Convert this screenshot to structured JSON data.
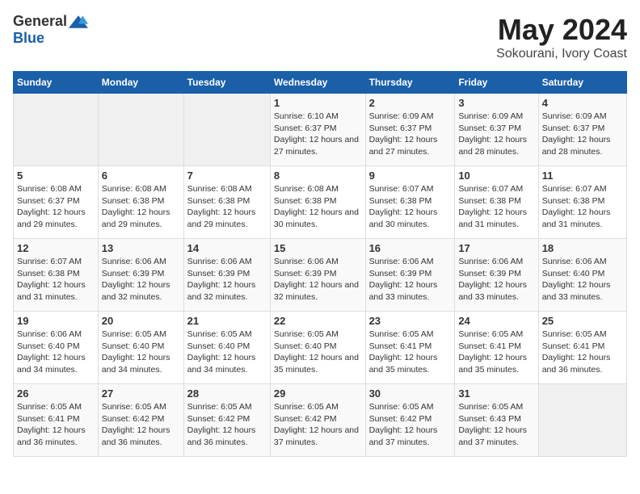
{
  "header": {
    "logo_general": "General",
    "logo_blue": "Blue",
    "title": "May 2024",
    "subtitle": "Sokourani, Ivory Coast"
  },
  "days_of_week": [
    "Sunday",
    "Monday",
    "Tuesday",
    "Wednesday",
    "Thursday",
    "Friday",
    "Saturday"
  ],
  "weeks": [
    [
      {
        "day": "",
        "info": ""
      },
      {
        "day": "",
        "info": ""
      },
      {
        "day": "",
        "info": ""
      },
      {
        "day": "1",
        "info": "Sunrise: 6:10 AM\nSunset: 6:37 PM\nDaylight: 12 hours and 27 minutes."
      },
      {
        "day": "2",
        "info": "Sunrise: 6:09 AM\nSunset: 6:37 PM\nDaylight: 12 hours and 27 minutes."
      },
      {
        "day": "3",
        "info": "Sunrise: 6:09 AM\nSunset: 6:37 PM\nDaylight: 12 hours and 28 minutes."
      },
      {
        "day": "4",
        "info": "Sunrise: 6:09 AM\nSunset: 6:37 PM\nDaylight: 12 hours and 28 minutes."
      }
    ],
    [
      {
        "day": "5",
        "info": "Sunrise: 6:08 AM\nSunset: 6:37 PM\nDaylight: 12 hours and 29 minutes."
      },
      {
        "day": "6",
        "info": "Sunrise: 6:08 AM\nSunset: 6:38 PM\nDaylight: 12 hours and 29 minutes."
      },
      {
        "day": "7",
        "info": "Sunrise: 6:08 AM\nSunset: 6:38 PM\nDaylight: 12 hours and 29 minutes."
      },
      {
        "day": "8",
        "info": "Sunrise: 6:08 AM\nSunset: 6:38 PM\nDaylight: 12 hours and 30 minutes."
      },
      {
        "day": "9",
        "info": "Sunrise: 6:07 AM\nSunset: 6:38 PM\nDaylight: 12 hours and 30 minutes."
      },
      {
        "day": "10",
        "info": "Sunrise: 6:07 AM\nSunset: 6:38 PM\nDaylight: 12 hours and 31 minutes."
      },
      {
        "day": "11",
        "info": "Sunrise: 6:07 AM\nSunset: 6:38 PM\nDaylight: 12 hours and 31 minutes."
      }
    ],
    [
      {
        "day": "12",
        "info": "Sunrise: 6:07 AM\nSunset: 6:38 PM\nDaylight: 12 hours and 31 minutes."
      },
      {
        "day": "13",
        "info": "Sunrise: 6:06 AM\nSunset: 6:39 PM\nDaylight: 12 hours and 32 minutes."
      },
      {
        "day": "14",
        "info": "Sunrise: 6:06 AM\nSunset: 6:39 PM\nDaylight: 12 hours and 32 minutes."
      },
      {
        "day": "15",
        "info": "Sunrise: 6:06 AM\nSunset: 6:39 PM\nDaylight: 12 hours and 32 minutes."
      },
      {
        "day": "16",
        "info": "Sunrise: 6:06 AM\nSunset: 6:39 PM\nDaylight: 12 hours and 33 minutes."
      },
      {
        "day": "17",
        "info": "Sunrise: 6:06 AM\nSunset: 6:39 PM\nDaylight: 12 hours and 33 minutes."
      },
      {
        "day": "18",
        "info": "Sunrise: 6:06 AM\nSunset: 6:40 PM\nDaylight: 12 hours and 33 minutes."
      }
    ],
    [
      {
        "day": "19",
        "info": "Sunrise: 6:06 AM\nSunset: 6:40 PM\nDaylight: 12 hours and 34 minutes."
      },
      {
        "day": "20",
        "info": "Sunrise: 6:05 AM\nSunset: 6:40 PM\nDaylight: 12 hours and 34 minutes."
      },
      {
        "day": "21",
        "info": "Sunrise: 6:05 AM\nSunset: 6:40 PM\nDaylight: 12 hours and 34 minutes."
      },
      {
        "day": "22",
        "info": "Sunrise: 6:05 AM\nSunset: 6:40 PM\nDaylight: 12 hours and 35 minutes."
      },
      {
        "day": "23",
        "info": "Sunrise: 6:05 AM\nSunset: 6:41 PM\nDaylight: 12 hours and 35 minutes."
      },
      {
        "day": "24",
        "info": "Sunrise: 6:05 AM\nSunset: 6:41 PM\nDaylight: 12 hours and 35 minutes."
      },
      {
        "day": "25",
        "info": "Sunrise: 6:05 AM\nSunset: 6:41 PM\nDaylight: 12 hours and 36 minutes."
      }
    ],
    [
      {
        "day": "26",
        "info": "Sunrise: 6:05 AM\nSunset: 6:41 PM\nDaylight: 12 hours and 36 minutes."
      },
      {
        "day": "27",
        "info": "Sunrise: 6:05 AM\nSunset: 6:42 PM\nDaylight: 12 hours and 36 minutes."
      },
      {
        "day": "28",
        "info": "Sunrise: 6:05 AM\nSunset: 6:42 PM\nDaylight: 12 hours and 36 minutes."
      },
      {
        "day": "29",
        "info": "Sunrise: 6:05 AM\nSunset: 6:42 PM\nDaylight: 12 hours and 37 minutes."
      },
      {
        "day": "30",
        "info": "Sunrise: 6:05 AM\nSunset: 6:42 PM\nDaylight: 12 hours and 37 minutes."
      },
      {
        "day": "31",
        "info": "Sunrise: 6:05 AM\nSunset: 6:43 PM\nDaylight: 12 hours and 37 minutes."
      },
      {
        "day": "",
        "info": ""
      }
    ]
  ]
}
